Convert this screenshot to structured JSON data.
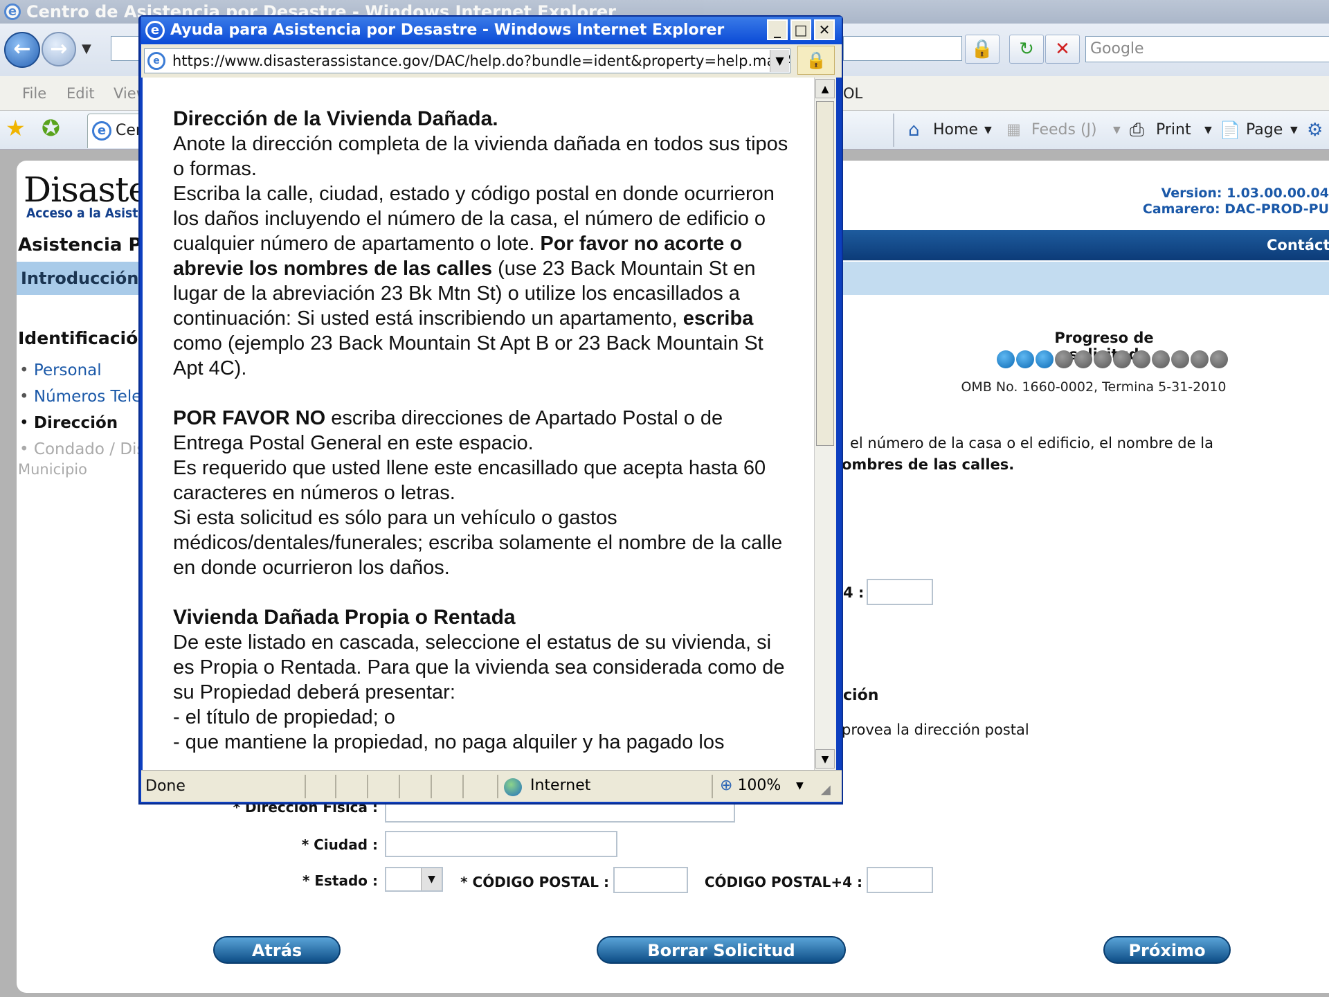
{
  "bg_window": {
    "title": "Centro de Asistencia por Desastre - Windows Internet Explorer",
    "search_placeholder": "Google",
    "menu": {
      "file": "File",
      "edit": "Edit",
      "view": "View",
      "right_fragment": "OL"
    },
    "tab_label": "Cer",
    "commands": {
      "home": "Home",
      "feeds": "Feeds (J)",
      "print": "Print",
      "page": "Page"
    }
  },
  "page": {
    "logo": "Disaster",
    "logo_sub": "Acceso a la Asiste",
    "version_line1": "Version: 1.03.00.00.04",
    "version_line2": "Camarero: DAC-PROD-PU",
    "header_title": "Asistencia P",
    "contact": "Contácte",
    "intro_tab": "Introducción",
    "sidebar": {
      "heading": "Identificación",
      "items": [
        {
          "label": "Personal",
          "state": "link"
        },
        {
          "label": "Números Tele",
          "state": "link"
        },
        {
          "label": "Dirección",
          "state": "current"
        },
        {
          "label": "Condado / Dis",
          "state": "disabled"
        },
        {
          "label": "Municipio",
          "state": "disabled"
        }
      ]
    },
    "progress": {
      "title": "Progreso de solicitud",
      "completed": 3,
      "total": 12
    },
    "omb": "OMB No. 1660-0002, Termina 5-31-2010",
    "instruction_line1": "el número de la casa o el edificio, el nombre de la",
    "instruction_line2": "ombres de las calles.",
    "zip4_label_top": "4 :",
    "section2_title": "ción",
    "section2_text": "provea la dirección postal",
    "form": {
      "direccion_label": "* Dirección Física :",
      "ciudad_label": "* Ciudad :",
      "estado_label": "* Estado :",
      "codigo_label": "* CÓDIGO POSTAL :",
      "codigo4_label": "CÓDIGO POSTAL+4 :"
    },
    "buttons": {
      "back": "Atrás",
      "clear": "Borrar Solicitud",
      "next": "Próximo"
    }
  },
  "popup": {
    "title": "Ayuda para Asistencia por Desastre - Windows Internet Explorer",
    "url": "https://www.disasterassistance.gov/DAC/help.do?bundle=ident&property=help.mailAddr",
    "heading1": "Dirección de la Vivienda Dañada.",
    "p1": "Anote la dirección completa de la vivienda dañada en todos sus tipos o formas.",
    "p2a": "Escriba la calle, ciudad, estado y código postal en donde ocurrieron los daños incluyendo el número de la casa, el número de edificio o cualquier número de apartamento o lote. ",
    "p2b": "Por favor no acorte o abrevie los nombres de las calles",
    "p2c": " (use 23 Back Mountain St en lugar de la abreviación 23 Bk Mtn St) o utilize los encasillados a continuación: Si usted está inscribiendo un apartamento, ",
    "p2d": "escriba",
    "p2e": " como (ejemplo 23 Back Mountain St Apt B or 23 Back Mountain St Apt 4C).",
    "p3a": "POR FAVOR NO",
    "p3b": " escriba direcciones de Apartado Postal o de Entrega Postal General en este espacio.",
    "p4": "Es requerido que usted llene este encasillado que acepta hasta 60 caracteres en números o letras.",
    "p5": "Si esta solicitud es sólo para un vehículo o gastos médicos/dentales/funerales; escriba solamente el nombre de la calle en donde ocurrieron los daños.",
    "heading2": "Vivienda Dañada Propia o Rentada",
    "p6": "De este listado en cascada, seleccione el estatus de su vivienda, si es Propia o Rentada. Para que la vivienda sea considerada como de su Propiedad deberá presentar:",
    "p7": "- el título de propiedad; o",
    "p8": "- que mantiene la propiedad, no paga alquiler y ha pagado los",
    "status": "Done",
    "zone": "Internet",
    "zoom": "100%"
  }
}
